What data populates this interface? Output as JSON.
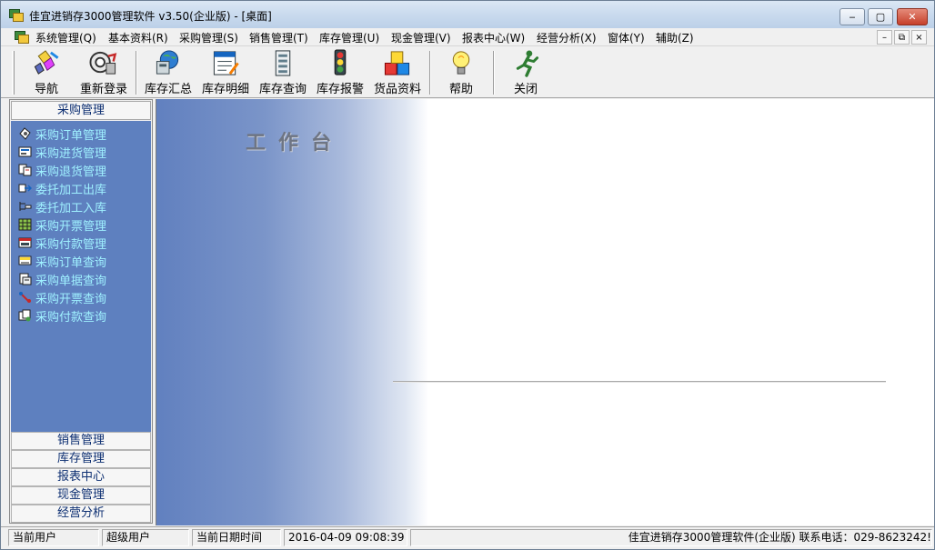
{
  "window": {
    "title": "佳宜进销存3000管理软件 v3.50(企业版) - [桌面]",
    "min_glyph": "‒",
    "max_glyph": "▢",
    "close_glyph": "✕"
  },
  "menu": {
    "items": [
      "系统管理(Q)",
      "基本资料(R)",
      "采购管理(S)",
      "销售管理(T)",
      "库存管理(U)",
      "现金管理(V)",
      "报表中心(W)",
      "经营分析(X)",
      "窗体(Y)",
      "辅助(Z)"
    ],
    "mdi_min": "–",
    "mdi_restore": "⧉",
    "mdi_close": "×"
  },
  "toolbar": {
    "buttons": [
      {
        "label": "导航",
        "icon": "navigation-icon"
      },
      {
        "label": "重新登录",
        "icon": "relogin-icon"
      },
      {
        "label": "库存汇总",
        "icon": "stock-summary-icon"
      },
      {
        "label": "库存明细",
        "icon": "stock-detail-icon"
      },
      {
        "label": "库存查询",
        "icon": "stock-query-icon"
      },
      {
        "label": "库存报警",
        "icon": "stock-alarm-icon"
      },
      {
        "label": "货品资料",
        "icon": "goods-info-icon"
      },
      {
        "label": "帮助",
        "icon": "help-icon"
      },
      {
        "label": "关闭",
        "icon": "close-icon"
      }
    ]
  },
  "sidebar": {
    "active_group": "采购管理",
    "items": [
      {
        "label": "采购订单管理",
        "icon": "purchase-order-icon"
      },
      {
        "label": "采购进货管理",
        "icon": "purchase-receive-icon"
      },
      {
        "label": "采购退货管理",
        "icon": "purchase-return-icon"
      },
      {
        "label": "委托加工出库",
        "icon": "outsource-out-icon"
      },
      {
        "label": "委托加工入库",
        "icon": "outsource-in-icon"
      },
      {
        "label": "采购开票管理",
        "icon": "purchase-invoice-icon"
      },
      {
        "label": "采购付款管理",
        "icon": "purchase-payment-icon"
      },
      {
        "label": "采购订单查询",
        "icon": "order-query-icon"
      },
      {
        "label": "采购单据查询",
        "icon": "document-query-icon"
      },
      {
        "label": "采购开票查询",
        "icon": "invoice-query-icon"
      },
      {
        "label": "采购付款查询",
        "icon": "payment-query-icon"
      }
    ],
    "groups": [
      "销售管理",
      "库存管理",
      "报表中心",
      "现金管理",
      "经营分析"
    ]
  },
  "desktop": {
    "title": "工作台"
  },
  "status": {
    "user_label": "当前用户",
    "user_value": "超级用户",
    "date_label": "当前日期时间",
    "date_value": "2016-04-09 09:08:39",
    "info": "佳宜进销存3000管理软件(企业版) 联系电话：029-8623242!"
  },
  "colors": {
    "sidebar_bg": "#5e80bf",
    "sidebar_text": "#9ff0ff",
    "group_text": "#0d2f72"
  }
}
